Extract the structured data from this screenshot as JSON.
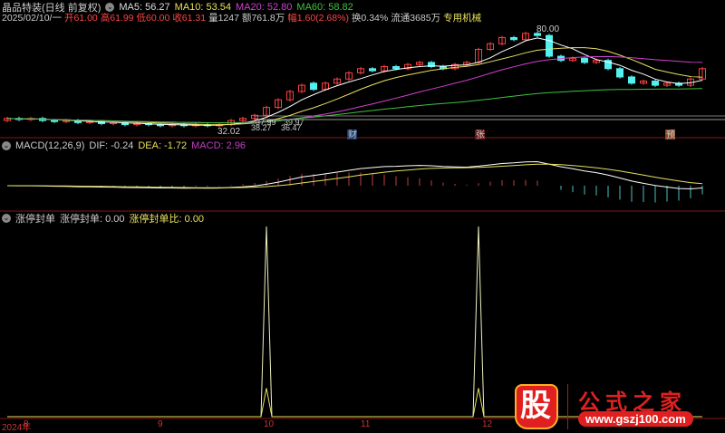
{
  "header": {
    "title": "晶品特装(日线 前复权)",
    "ma5": "MA5: 56.27",
    "ma10": "MA10: 53.54",
    "ma20": "MA20: 52.80",
    "ma60": "MA60: 58.82",
    "date": "2025/02/10/一",
    "open": "开61.00",
    "high": "高61.99",
    "low": "低60.00",
    "close": "收61.31",
    "volume": "量1247",
    "amount": "额761.8万",
    "change": "幅1.60(2.68%)",
    "turnover": "换0.34%",
    "float": "流通3685万",
    "industry": "专用机械"
  },
  "macd_header": {
    "name": "MACD(12,26,9)",
    "dif": "DIF: -0.24",
    "dea": "DEA: -1.72",
    "macd": "MACD: 2.96"
  },
  "seal_header": {
    "name": "涨停封单",
    "v1": "涨停封单: 0.00",
    "v2": "涨停封单比: 0.00"
  },
  "annotations": {
    "max": "80.00",
    "min": "32.02",
    "a1": "37.99",
    "a2": "39.97",
    "a3": "38.27",
    "a4": "36.47"
  },
  "markers": [
    "财",
    "张",
    "预"
  ],
  "x_axis": [
    "2024年",
    "8",
    "9",
    "10",
    "11",
    "12"
  ],
  "logo": {
    "title": "公式之家",
    "url": "www.gszj100.com",
    "mark": "股"
  },
  "colors": {
    "up": "#ff4040",
    "down": "#54f0f0",
    "ma5": "#ffffff",
    "ma10": "#e8e060",
    "ma20": "#d040d0",
    "ma60": "#40c040"
  },
  "chart_data": {
    "type": "candlestick",
    "close": [
      36,
      35.5,
      36,
      35,
      34.5,
      35,
      34,
      34.5,
      33.5,
      34,
      33,
      33.5,
      33,
      32.5,
      33,
      32.5,
      33,
      32.5,
      33,
      35,
      36,
      37.5,
      41.3,
      45,
      49,
      52,
      50,
      53,
      55,
      58,
      60,
      59,
      61,
      60,
      62,
      63,
      61,
      60,
      62,
      63,
      69.3,
      72,
      75,
      74,
      77,
      76,
      66,
      64,
      65,
      63,
      64,
      60,
      56,
      53,
      54,
      52,
      53,
      52,
      55,
      60
    ],
    "open": [
      35,
      36,
      35.5,
      36,
      35,
      34.5,
      35,
      34,
      34.5,
      33.5,
      34,
      33,
      33.5,
      33,
      32.5,
      33,
      32.5,
      33,
      32.5,
      33,
      35,
      36,
      37.5,
      41.3,
      45,
      49,
      53,
      50,
      53,
      55,
      58,
      60,
      59,
      61,
      60,
      62,
      63,
      61,
      60,
      62,
      63,
      69.3,
      72,
      75,
      74,
      77,
      76,
      66,
      64,
      65,
      63,
      64,
      60,
      56,
      53,
      54,
      52,
      53,
      52,
      55
    ],
    "limit_up_seal": [
      0,
      0,
      0,
      0,
      0,
      0,
      0,
      0,
      0,
      0,
      0,
      0,
      0,
      0,
      0,
      0,
      0,
      0,
      0,
      0,
      0,
      0,
      1,
      0,
      0,
      0,
      0,
      0,
      0,
      0,
      0,
      0,
      0,
      0,
      0,
      0,
      0,
      0,
      0,
      0,
      1,
      0,
      0,
      0,
      0,
      0,
      0,
      0,
      0,
      0,
      0,
      0,
      0,
      0,
      0,
      0,
      0,
      0,
      0,
      0
    ]
  }
}
